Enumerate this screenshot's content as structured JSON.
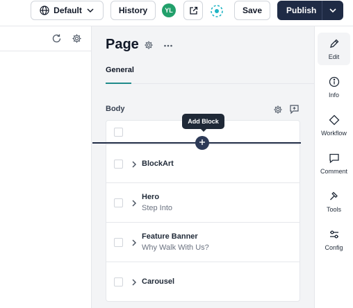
{
  "topbar": {
    "locale_label": "Default",
    "history_label": "History",
    "avatar_initials": "YL",
    "save_label": "Save",
    "publish_label": "Publish"
  },
  "page": {
    "title": "Page",
    "tabs": [
      {
        "label": "General",
        "active": true
      }
    ],
    "section_label": "Body",
    "tooltip": "Add Block",
    "blocks": [
      {
        "name": "BlockArt",
        "subtitle": ""
      },
      {
        "name": "Hero",
        "subtitle": "Step Into"
      },
      {
        "name": "Feature Banner",
        "subtitle": "Why Walk With Us?"
      },
      {
        "name": "Carousel",
        "subtitle": ""
      }
    ]
  },
  "rail": {
    "items": [
      {
        "label": "Edit",
        "icon": "pencil-icon",
        "active": true
      },
      {
        "label": "Info",
        "icon": "info-icon"
      },
      {
        "label": "Workflow",
        "icon": "diamond-icon"
      },
      {
        "label": "Comment",
        "icon": "comment-icon"
      },
      {
        "label": "Tools",
        "icon": "hammer-icon"
      },
      {
        "label": "Config",
        "icon": "sliders-icon"
      }
    ]
  },
  "colors": {
    "publish_bg": "#1f2b45",
    "avatar_bg": "#22a06b",
    "tab_accent": "#1f8a8a",
    "sync_accent": "#1fb5c4"
  }
}
